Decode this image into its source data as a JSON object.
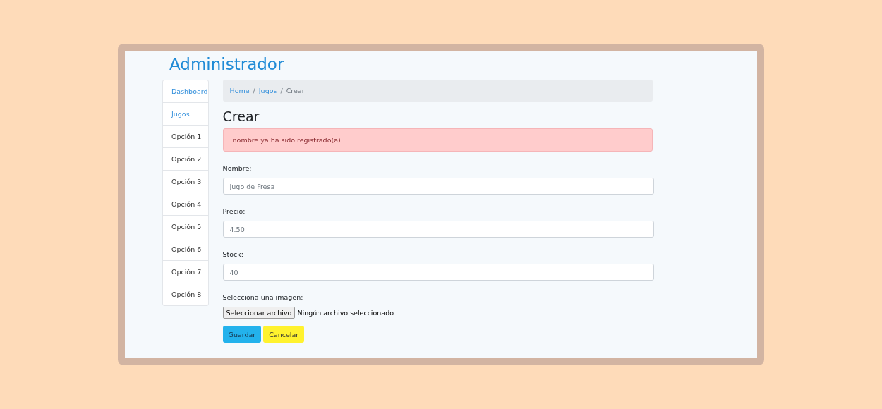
{
  "header": {
    "title": "Administrador"
  },
  "sidebar": {
    "items": [
      {
        "label": "Dashboard",
        "kind": "link"
      },
      {
        "label": "Jugos",
        "kind": "link"
      },
      {
        "label": "Opción 1",
        "kind": "text"
      },
      {
        "label": "Opción 2",
        "kind": "text"
      },
      {
        "label": "Opción 3",
        "kind": "text"
      },
      {
        "label": "Opción 4",
        "kind": "text"
      },
      {
        "label": "Opción 5",
        "kind": "text"
      },
      {
        "label": "Opción 6",
        "kind": "text"
      },
      {
        "label": "Opción 7",
        "kind": "text"
      },
      {
        "label": "Opción 8",
        "kind": "text"
      }
    ]
  },
  "breadcrumb": [
    {
      "label": "Home",
      "kind": "link"
    },
    {
      "label": "/",
      "kind": "separator"
    },
    {
      "label": "Jugos",
      "kind": "link"
    },
    {
      "label": "/",
      "kind": "separator"
    },
    {
      "label": "Crear",
      "kind": "current"
    }
  ],
  "page_title": "Crear",
  "alert": {
    "message": "nombre ya ha sido registrado(a)."
  },
  "form": {
    "fields": [
      {
        "label": "Nombre:",
        "value": "Jugo de Fresa"
      },
      {
        "label": "Precio:",
        "value": "4.50"
      },
      {
        "label": "Stock:",
        "value": "40"
      }
    ],
    "file": {
      "label": "Selecciona una imagen:",
      "button": "Seleccionar archivo",
      "status": "Ningún archivo seleccionado"
    },
    "buttons": [
      {
        "label": "Guardar",
        "kind": "primary"
      },
      {
        "label": "Cancelar",
        "kind": "warning"
      }
    ]
  }
}
